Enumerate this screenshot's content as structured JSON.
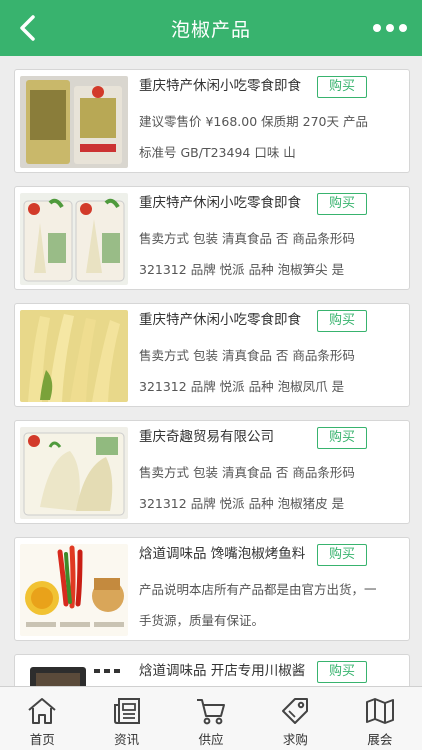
{
  "header": {
    "title": "泡椒产品"
  },
  "products": [
    {
      "name": "重庆特产休闲小吃零食即食",
      "buy_label": "购买",
      "desc": "建议零售价 ¥168.00 保质期 270天 产品标准号 GB/T23494 口味 山"
    },
    {
      "name": "重庆特产休闲小吃零食即食",
      "buy_label": "购买",
      "desc": "售卖方式 包装 清真食品 否 商品条形码 321312 品牌 悦派 品种 泡椒笋尖 是"
    },
    {
      "name": "重庆特产休闲小吃零食即食",
      "buy_label": "购买",
      "desc": "售卖方式 包装 清真食品 否 商品条形码 321312 品牌 悦派 品种 泡椒凤爪 是"
    },
    {
      "name": "重庆奇趣贸易有限公司",
      "buy_label": "购买",
      "desc": "售卖方式 包装 清真食品 否 商品条形码 321312 品牌 悦派 品种 泡椒猪皮 是"
    },
    {
      "name": "焓道调味品 馋嘴泡椒烤鱼料",
      "buy_label": "购买",
      "desc": "产品说明本店所有产品都是由官方出货，一手货源，质量有保证。"
    },
    {
      "name": "焓道调味品 开店专用川椒酱",
      "buy_label": "购买",
      "desc": ""
    }
  ],
  "tabbar": {
    "items": [
      {
        "label": "首页",
        "icon": "home-icon"
      },
      {
        "label": "资讯",
        "icon": "news-icon"
      },
      {
        "label": "供应",
        "icon": "cart-icon"
      },
      {
        "label": "求购",
        "icon": "tag-icon"
      },
      {
        "label": "展会",
        "icon": "map-icon"
      }
    ]
  },
  "colors": {
    "accent": "#38b36e",
    "background": "#ededed"
  }
}
